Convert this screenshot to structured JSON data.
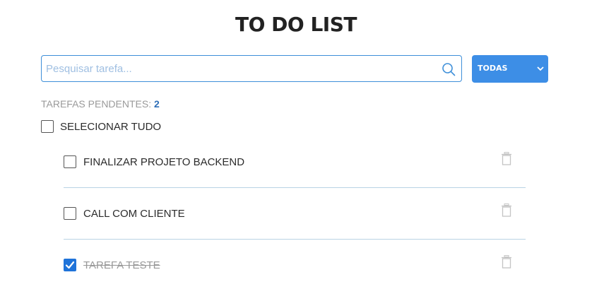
{
  "header": {
    "title": "TO DO LIST"
  },
  "search": {
    "placeholder": "Pesquisar tarefa...",
    "value": ""
  },
  "filter": {
    "selected": "TODAS",
    "color": "#3d8ee6"
  },
  "pending": {
    "label": "TAREFAS PENDENTES:",
    "count": "2"
  },
  "select_all": {
    "label": "SELECIONAR TUDO",
    "checked": false
  },
  "tasks": [
    {
      "label": "FINALIZAR PROJETO BACKEND",
      "checked": false,
      "icon": "trash-icon"
    },
    {
      "label": "CALL COM CLIENTE",
      "checked": false,
      "icon": "trash-icon"
    },
    {
      "label": "TAREFA TESTE",
      "checked": true,
      "icon": "trash-icon"
    }
  ],
  "colors": {
    "accent": "#3e8fd9",
    "divider": "#b9d3e4",
    "checked": "#1f73d9"
  }
}
